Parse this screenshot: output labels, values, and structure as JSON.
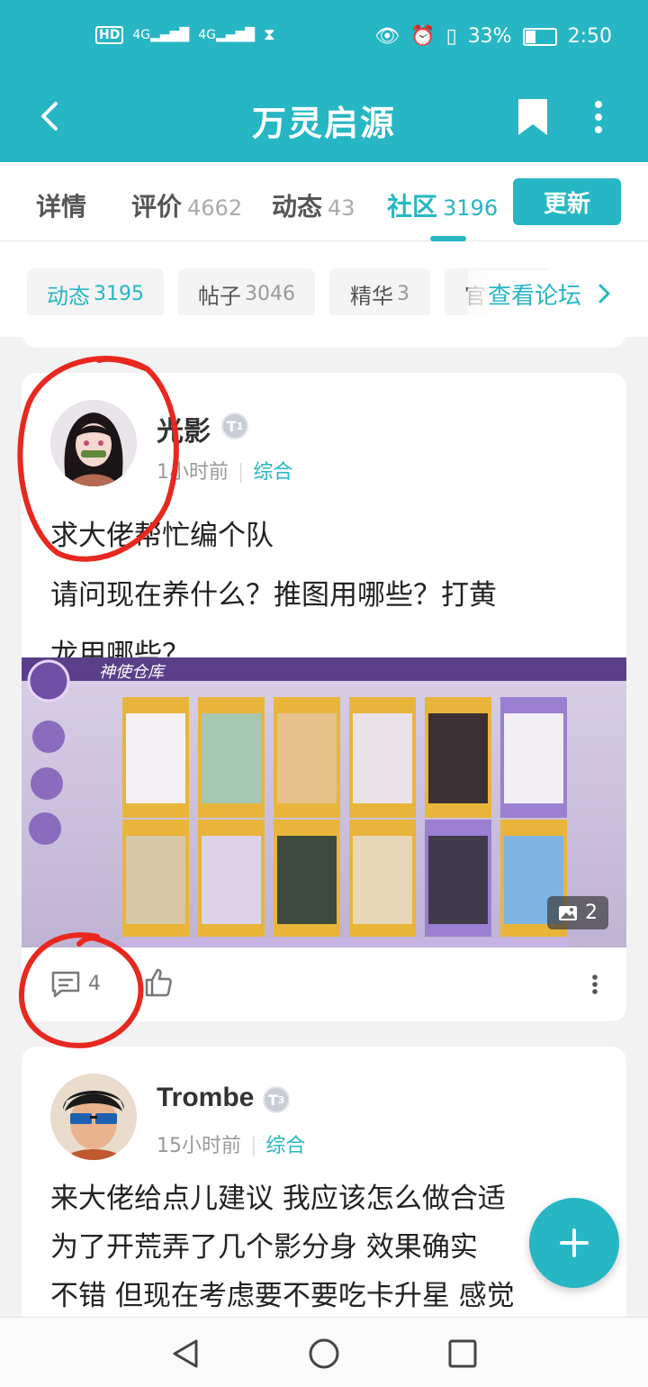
{
  "status_bar": {
    "network_left": [
      "HD",
      "4G",
      "4G"
    ],
    "battery": "33%",
    "time": "2:50"
  },
  "app_bar": {
    "title": "万灵启源"
  },
  "tabs": [
    {
      "label": "详情",
      "count": ""
    },
    {
      "label": "评价",
      "count": "4662"
    },
    {
      "label": "动态",
      "count": "43"
    },
    {
      "label": "社区",
      "count": "3196"
    }
  ],
  "update_button": "更新",
  "subtabs": [
    {
      "label": "动态",
      "count": "3195"
    },
    {
      "label": "帖子",
      "count": "3046"
    },
    {
      "label": "精华",
      "count": "3"
    },
    {
      "label": "官",
      "count": ""
    }
  ],
  "forum_link": "查看论坛",
  "posts": [
    {
      "user": "光影",
      "level": "1",
      "time": "1小时前",
      "category": "综合",
      "text_lines": [
        "求大佬帮忙编个队",
        "请问现在养什么？推图用哪些？打黄",
        "龙用哪些？"
      ],
      "image_title": "神使仓库",
      "image_count": "2",
      "comments": "4"
    },
    {
      "user": "Trombe",
      "level": "3",
      "time": "15小时前",
      "category": "综合",
      "text_lines": [
        "来大佬给点儿建议 我应该怎么做合适",
        "为了开荒弄了几个影分身 效果确实",
        "不错 但现在考虑要不要吃卡升星 感觉"
      ]
    }
  ],
  "colors": {
    "accent": "#26b6c4",
    "annotation": "#e8281e"
  }
}
